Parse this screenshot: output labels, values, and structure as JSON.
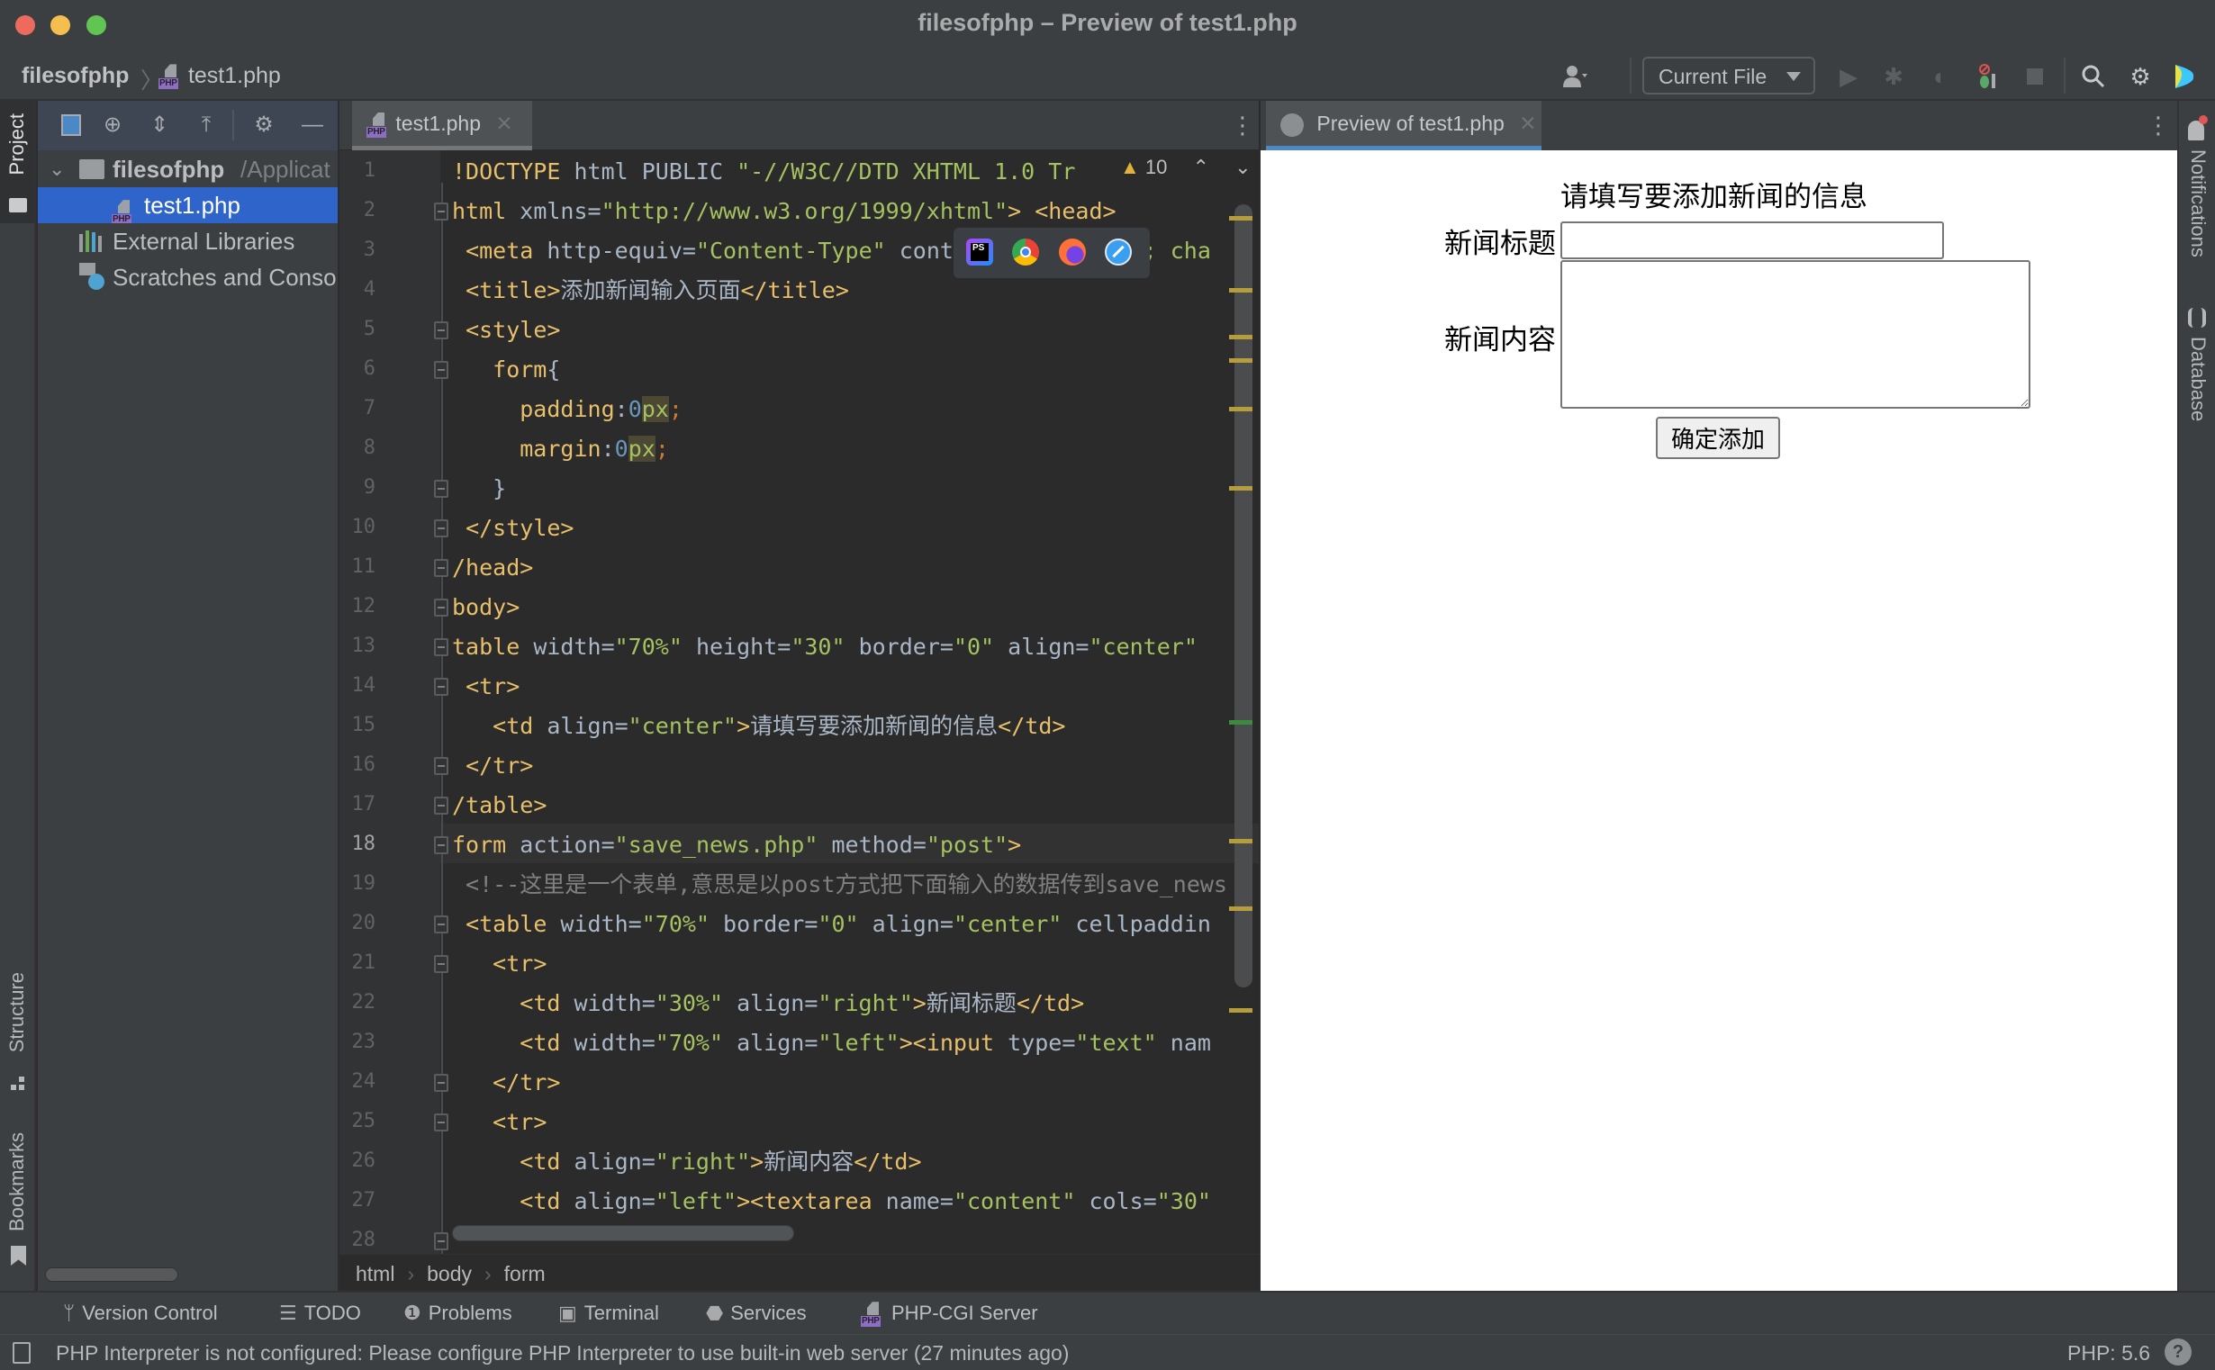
{
  "window": {
    "title": "filesofphp – Preview of test1.php"
  },
  "toolbar": {
    "breadcrumb_project": "filesofphp",
    "breadcrumb_file": "test1.php",
    "run_config": "Current File",
    "icons": [
      "user-icon",
      "run-icon",
      "debug-icon",
      "coverage-icon",
      "stop-debug-icon",
      "stop-icon",
      "search-icon",
      "settings-icon",
      "jetbrains-logo-icon"
    ]
  },
  "left_strip": {
    "project_label": "Project",
    "structure_label": "Structure",
    "bookmarks_label": "Bookmarks"
  },
  "project_panel": {
    "toolbar_icons": [
      "select-opened-file-icon",
      "locate-icon",
      "expand-all-icon",
      "collapse-all-icon",
      "settings-icon",
      "hide-icon"
    ],
    "tree": [
      {
        "label": "filesofphp",
        "suffix": "/Applicat",
        "type": "folder",
        "expanded": true
      },
      {
        "label": "test1.php",
        "type": "php-file",
        "selected": true
      },
      {
        "label": "External Libraries",
        "type": "libraries"
      },
      {
        "label": "Scratches and Consoles",
        "type": "scratches"
      }
    ]
  },
  "editor": {
    "tab_label": "test1.php",
    "inspection_warning_count": "10",
    "current_line": 18,
    "line_numbers": [
      "1",
      "2",
      "3",
      "4",
      "5",
      "6",
      "7",
      "8",
      "9",
      "10",
      "11",
      "12",
      "13",
      "14",
      "15",
      "16",
      "17",
      "18",
      "19",
      "20",
      "21",
      "22",
      "23",
      "24",
      "25",
      "26",
      "27",
      "28"
    ],
    "lines": [
      "!DOCTYPE html PUBLIC \"-//W3C//DTD XHTML 1.0 Tr",
      "html xmlns=\"http://www.w3.org/1999/xhtml\"> <head>",
      " <meta http-equiv=\"Content-Type\" content=\"text/html; cha",
      " <title>添加新闻输入页面</title>",
      " <style>",
      "   form{",
      "     padding:0px;",
      "     margin:0px;",
      "   }",
      " </style>",
      "/head>",
      "body>",
      "table width=\"70%\" height=\"30\" border=\"0\" align=\"center\"",
      " <tr>",
      "   <td align=\"center\">请填写要添加新闻的信息</td>",
      " </tr>",
      "/table>",
      "form action=\"save_news.php\" method=\"post\">",
      " <!--这里是一个表单,意思是以post方式把下面输入的数据传到save_news",
      " <table width=\"70%\" border=\"0\" align=\"center\" cellpaddin",
      "   <tr>",
      "     <td width=\"30%\" align=\"right\">新闻标题</td>",
      "     <td width=\"70%\" align=\"left\"><input type=\"text\" nam",
      "   </tr>",
      "   <tr>",
      "     <td align=\"right\">新闻内容</td>",
      "     <td align=\"left\"><textarea name=\"content\" cols=\"30\"",
      ""
    ],
    "browser_popup": [
      "phpstorm-icon",
      "chrome-icon",
      "firefox-icon",
      "safari-icon"
    ]
  },
  "breadcrumb": [
    "html",
    "body",
    "form"
  ],
  "preview": {
    "tab_label": "Preview of test1.php",
    "heading": "请填写要添加新闻的信息",
    "title_label": "新闻标题",
    "title_value": "",
    "content_label": "新闻内容",
    "content_value": "",
    "submit_label": "确定添加"
  },
  "right_strip": {
    "notifications_label": "Notifications",
    "database_label": "Database"
  },
  "bottom_bar": [
    {
      "label": "Version Control",
      "icon": "version-control-icon"
    },
    {
      "label": "TODO",
      "icon": "todo-icon"
    },
    {
      "label": "Problems",
      "icon": "problems-icon"
    },
    {
      "label": "Terminal",
      "icon": "terminal-icon"
    },
    {
      "label": "Services",
      "icon": "services-icon"
    },
    {
      "label": "PHP-CGI Server",
      "icon": "php-icon"
    }
  ],
  "status_bar": {
    "message": "PHP Interpreter is not configured: Please configure PHP Interpreter to use built-in web server (27 minutes ago)",
    "php_version": "PHP: 5.6"
  },
  "colors": {
    "accent_blue": "#2f65ca",
    "preview_tab_underline": "#4a88c7",
    "warning_mark": "#b69c3a"
  }
}
